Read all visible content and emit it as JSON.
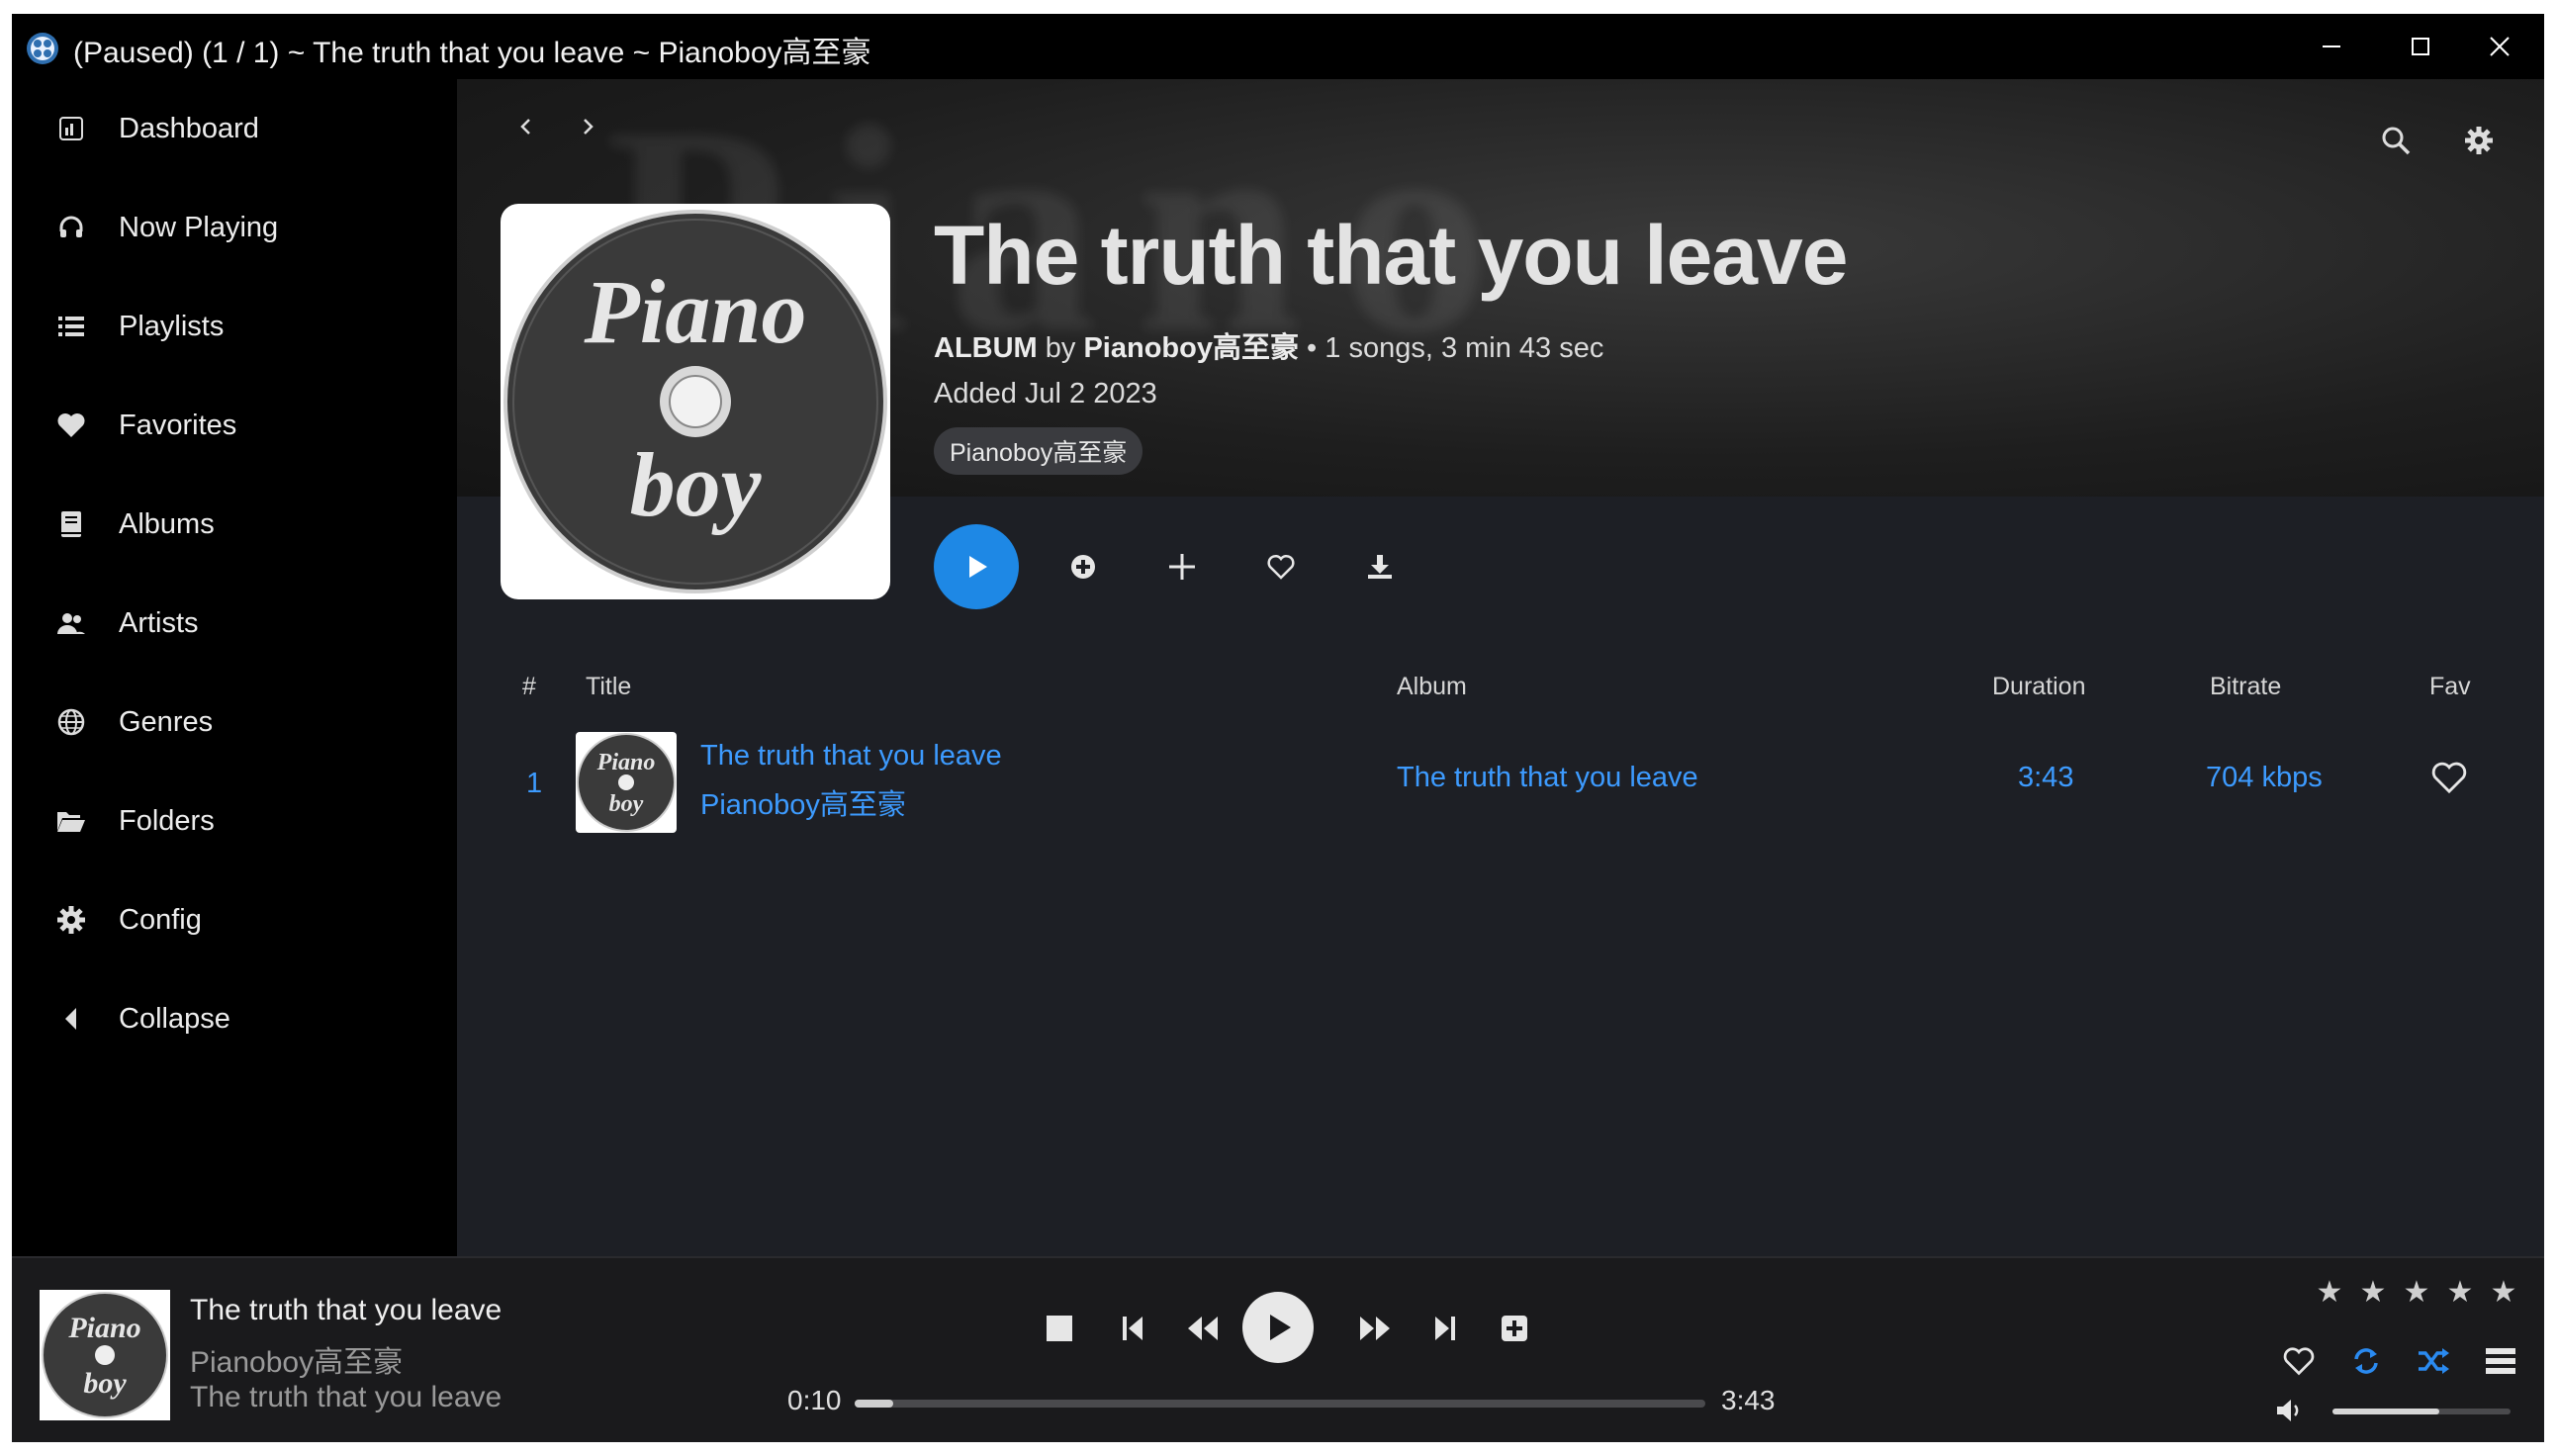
{
  "window": {
    "title": "(Paused) (1 / 1) ~ The truth that you leave ~ Pianoboy高至豪",
    "controls": {
      "minimize_icon": "minimize-icon",
      "maximize_icon": "maximize-icon",
      "close_icon": "close-icon"
    }
  },
  "sidebar": {
    "items": [
      {
        "label": "Dashboard",
        "icon": "dashboard-icon"
      },
      {
        "label": "Now Playing",
        "icon": "headphones-icon"
      },
      {
        "label": "Playlists",
        "icon": "list-icon"
      },
      {
        "label": "Favorites",
        "icon": "heart-icon"
      },
      {
        "label": "Albums",
        "icon": "book-icon"
      },
      {
        "label": "Artists",
        "icon": "users-icon"
      },
      {
        "label": "Genres",
        "icon": "globe-icon"
      },
      {
        "label": "Folders",
        "icon": "folder-open-icon"
      },
      {
        "label": "Config",
        "icon": "gear-icon"
      },
      {
        "label": "Collapse",
        "icon": "chevron-left-icon"
      }
    ]
  },
  "album": {
    "title": "The truth that you leave",
    "type": "ALBUM",
    "by": "by",
    "artist": "Pianoboy高至豪",
    "stats": "• 1 songs, 3 min 43 sec",
    "added": "Added Jul 2 2023",
    "genre_chip": "Pianoboy高至豪",
    "cover_text_top": "Piano",
    "cover_text_bottom": "boy"
  },
  "table": {
    "headers": {
      "num": "#",
      "title": "Title",
      "album": "Album",
      "duration": "Duration",
      "bitrate": "Bitrate",
      "fav": "Fav"
    },
    "rows": [
      {
        "num": "1",
        "title": "The truth that you leave",
        "artist": "Pianoboy高至豪",
        "album": "The truth that you leave",
        "duration": "3:43",
        "bitrate": "704 kbps"
      }
    ]
  },
  "player": {
    "title": "The truth that you leave",
    "artist": "Pianoboy高至豪",
    "album": "The truth that you leave",
    "elapsed": "0:10",
    "total": "3:43",
    "progress": 0.045,
    "volume": 0.6,
    "rating_stars": 5
  },
  "colors": {
    "accent": "#1e88e5",
    "link": "#3d9bff"
  }
}
